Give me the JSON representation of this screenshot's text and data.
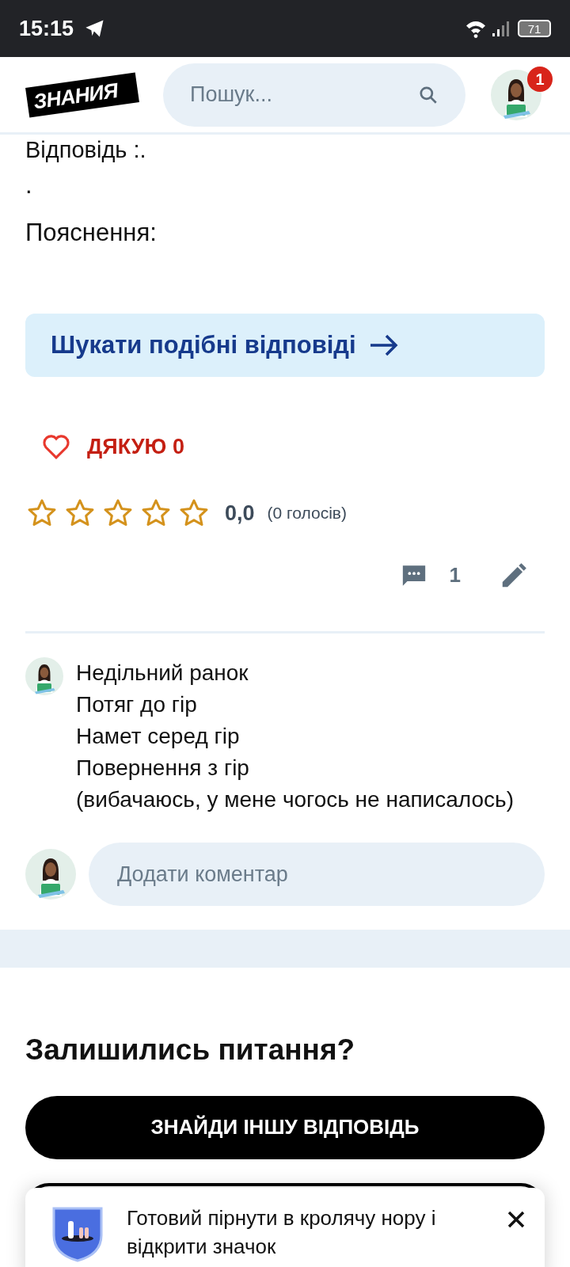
{
  "status_bar": {
    "time": "15:15",
    "battery": "71"
  },
  "header": {
    "logo": "ЗНАНИЯ",
    "search": {
      "placeholder": "Пошук..."
    },
    "notification_count": "1"
  },
  "answer": {
    "cut_line": "Відповідь :.",
    "lines": [
      ".",
      "Пояснення:"
    ]
  },
  "similar_button": "Шукати подібні відповіді",
  "thanks": {
    "label": "ДЯКУЮ 0",
    "liked": false
  },
  "rating": {
    "stars": 0,
    "value": "0,0",
    "votes": "(0 голосів)"
  },
  "comments_count": "1",
  "comment": {
    "lines": [
      "Недільний ранок",
      "Потяг до гір",
      "Намет серед гір",
      "Повернення з гір",
      "(вибачаюсь, у мене чогось не написалось)"
    ]
  },
  "add_comment": {
    "placeholder": "Додати коментар"
  },
  "more": {
    "title": "Залишились питання?",
    "button": "ЗНАЙДИ ІНШУ ВІДПОВІДЬ"
  },
  "toast": {
    "text": "Готовий пірнути в кролячу нору і відкрити значок"
  }
}
